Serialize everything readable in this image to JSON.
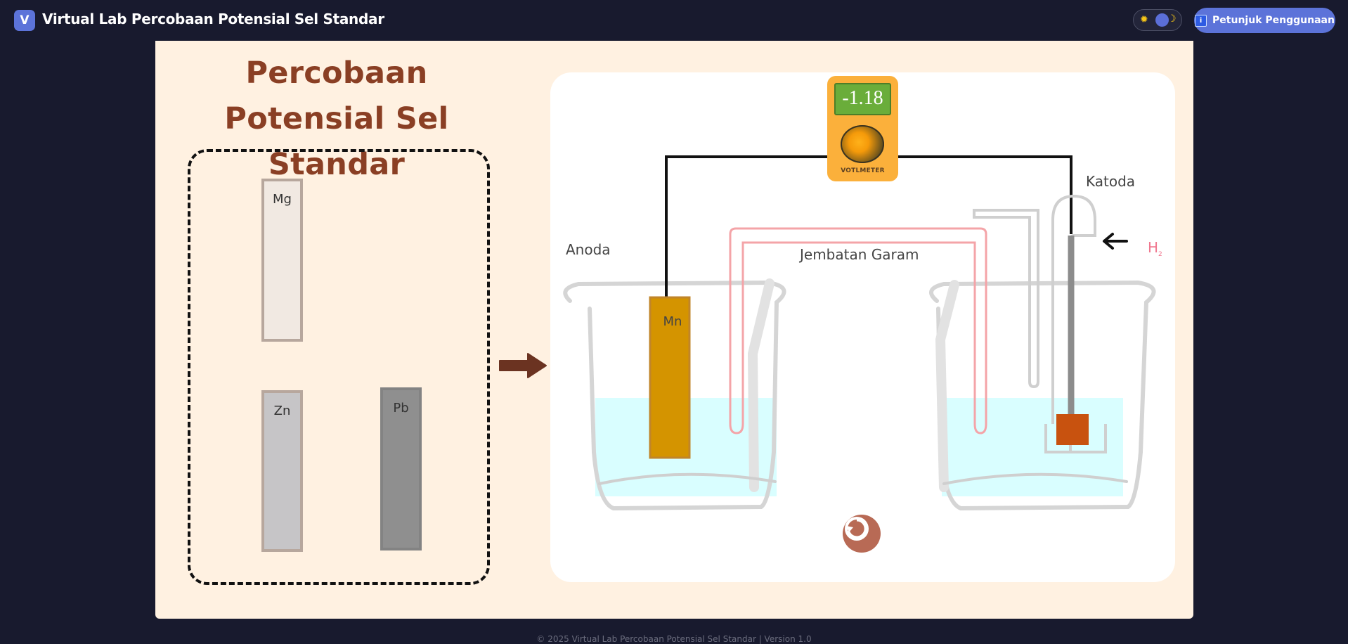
{
  "header": {
    "logo_letter": "V",
    "title": "Virtual Lab Percobaan Potensial Sel Standar",
    "help_label": "Petunjuk Penggunaan",
    "theme_sun_icon": "✹",
    "theme_moon_icon": "☽"
  },
  "left_panel": {
    "heading_line1": "Percobaan",
    "heading_line2": "Potensial Sel Standar",
    "metals": [
      {
        "symbol": "Mg",
        "color": "#f1e9e2"
      },
      {
        "symbol": "Zn",
        "color": "#c6c5c7"
      },
      {
        "symbol": "Pb",
        "color": "#8f8f8f"
      }
    ]
  },
  "lab": {
    "voltmeter_reading": "-1.18",
    "voltmeter_label": "VOTLMETER",
    "anode_label": "Anoda",
    "cathode_label": "Katoda",
    "salt_bridge_label": "Jembatan Garam",
    "anode_metal": "Mn",
    "gas_label": "H",
    "gas_subscript": "2",
    "colors": {
      "anode_metal": "#d49400",
      "cathode_electrode": "#c8520f",
      "solution": "#d9feff",
      "salt_bridge": "#f49a9f",
      "voltmeter": "#fbb03b"
    }
  },
  "footer": {
    "text": "© 2025 Virtual Lab Percobaan Potensial Sel Standar | Version 1.0"
  }
}
